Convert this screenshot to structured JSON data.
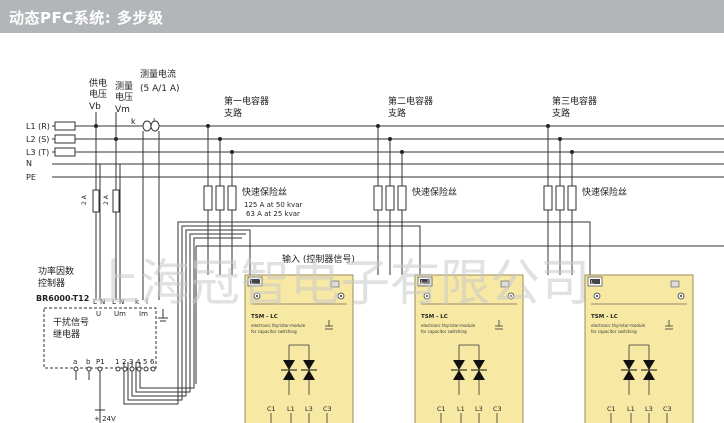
{
  "header": {
    "title": "动态PFC系统:  多步级"
  },
  "measure": {
    "vb": [
      "供电",
      "电压",
      "Vb"
    ],
    "vm": [
      "测量",
      "电压",
      "Vm"
    ],
    "current": [
      "测量电流",
      "(5 A/1 A)"
    ],
    "k": "k",
    "l": "l"
  },
  "lines": {
    "l1": "L1 (R)",
    "l2": "L2 (S)",
    "l3": "L3 (T)",
    "n": "N",
    "pe": "PE"
  },
  "branches": [
    {
      "line1": "第一电容器",
      "line2": "支路"
    },
    {
      "line1": "第二电容器",
      "line2": "支路"
    },
    {
      "line1": "第三电容器",
      "line2": "支路"
    }
  ],
  "fuse": {
    "label": "快速保险丝",
    "rating1": "125 A at 50 kvar",
    "rating2": "63 A at 25 kvar",
    "small": "2 A"
  },
  "input_label": "输入 (控制器信号)",
  "controller": {
    "title1": "功率因数",
    "title2": "控制器",
    "model": "BR6000-T12",
    "terminals_top": [
      "L",
      "N",
      "L",
      "N",
      "k",
      "l"
    ],
    "group_labels": [
      "U",
      "Um",
      "Im"
    ],
    "relay1": "干扰信号",
    "relay2": "继电器",
    "terminals_bottom": [
      "a",
      "b",
      "P1",
      "1",
      "2",
      "3",
      "4",
      "5",
      "6"
    ],
    "supply": "+ 24V"
  },
  "module": {
    "name": "TSM - LC",
    "desc1": "electronic thyristor-module",
    "desc2": "for capacitor switching",
    "led_top": "L",
    "terminals": [
      "C1",
      "L1",
      "L3",
      "C3"
    ]
  },
  "watermark": "上海冠智电子有限公司",
  "colors": {
    "header": "#b3b6b9",
    "module": "#f7e9a4",
    "wire": "#333333",
    "watermark": "#c8c8c8"
  }
}
